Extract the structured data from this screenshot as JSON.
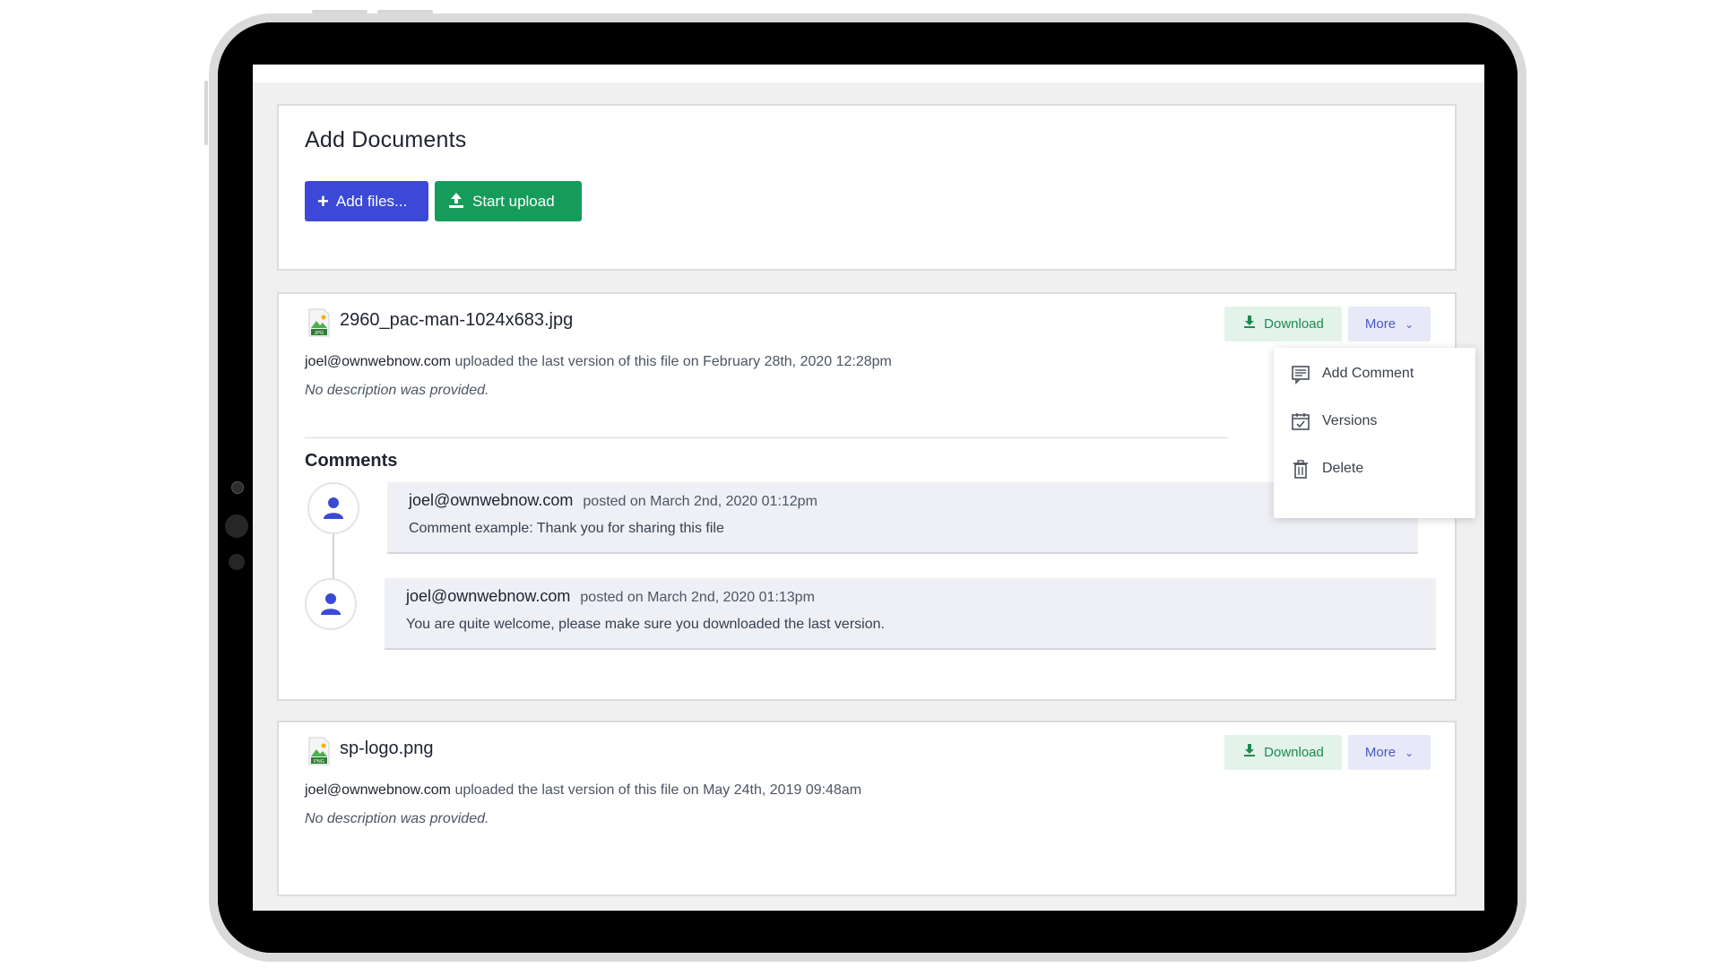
{
  "upload_card": {
    "title": "Add Documents",
    "add_files_label": "Add files...",
    "start_upload_label": "Start upload"
  },
  "files": [
    {
      "name": "2960_pac-man-1024x683.jpg",
      "type_badge": "JPG",
      "uploader": "joel@ownwebnow.com",
      "upload_text": "uploaded the last version of this file on February 28th, 2020 12:28pm",
      "description": "No description was provided.",
      "download_label": "Download",
      "more_label": "More"
    },
    {
      "name": "sp-logo.png",
      "type_badge": "PNG",
      "uploader": "joel@ownwebnow.com",
      "upload_text": "uploaded the last version of this file on May 24th, 2019 09:48am",
      "description": "No description was provided.",
      "download_label": "Download",
      "more_label": "More"
    }
  ],
  "comments": {
    "title": "Comments",
    "items": [
      {
        "author": "joel@ownwebnow.com",
        "posted": "posted on March 2nd, 2020 01:12pm",
        "text": "Comment example: Thank you for sharing this file"
      },
      {
        "author": "joel@ownwebnow.com",
        "posted": "posted on March 2nd, 2020 01:13pm",
        "text": "You are quite welcome, please make sure you downloaded the last version."
      }
    ]
  },
  "more_menu": {
    "items": [
      {
        "label": "Add Comment",
        "icon": "comment-icon"
      },
      {
        "label": "Versions",
        "icon": "calendar-check-icon"
      },
      {
        "label": "Delete",
        "icon": "trash-icon"
      }
    ]
  },
  "colors": {
    "primary": "#3b49d6",
    "success": "#169c5a",
    "download_bg": "#e3f3ea",
    "more_bg": "#e7e9f8"
  }
}
